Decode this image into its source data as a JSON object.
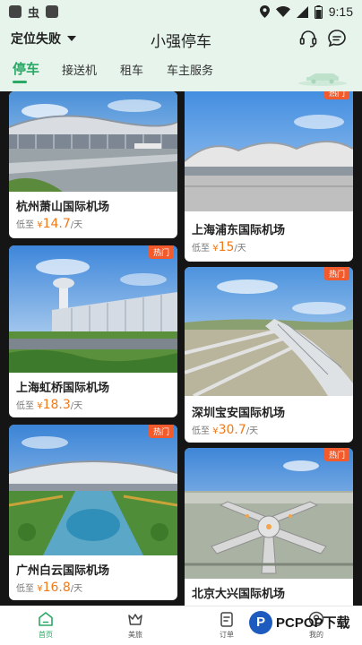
{
  "status_bar": {
    "time": "9:15",
    "bug_glyph": "虫"
  },
  "header": {
    "location": "定位失败",
    "title": "小强停车"
  },
  "tabs": [
    {
      "label": "停车",
      "active": true
    },
    {
      "label": "接送机",
      "active": false
    },
    {
      "label": "租车",
      "active": false
    },
    {
      "label": "车主服务",
      "active": false
    }
  ],
  "price_prefix": "低至",
  "currency": "¥",
  "price_unit": "/天",
  "badge_label": "热门",
  "cards": [
    {
      "name": "杭州萧山国际机场",
      "price": "14.7",
      "hot": false
    },
    {
      "name": "上海浦东国际机场",
      "price": "15",
      "hot": true
    },
    {
      "name": "上海虹桥国际机场",
      "price": "18.3",
      "hot": true
    },
    {
      "name": "深圳宝安国际机场",
      "price": "30.7",
      "hot": true
    },
    {
      "name": "广州白云国际机场",
      "price": "16.8",
      "hot": true
    },
    {
      "name": "北京大兴国际机场",
      "price": "",
      "hot": true
    }
  ],
  "bottom_nav": [
    {
      "label": "首页",
      "icon": "home-icon",
      "active": true
    },
    {
      "label": "美旅",
      "icon": "crown-icon",
      "active": false
    },
    {
      "label": "订单",
      "icon": "order-icon",
      "active": false
    },
    {
      "label": "我的",
      "icon": "profile-icon",
      "active": false
    }
  ],
  "watermark": {
    "text": "PCPOP下载",
    "letter": "P"
  },
  "colors": {
    "accent": "#2aa865",
    "price": "#f07a1a",
    "badge": "#f35a2c",
    "header_bg": "#e6f4ec"
  }
}
